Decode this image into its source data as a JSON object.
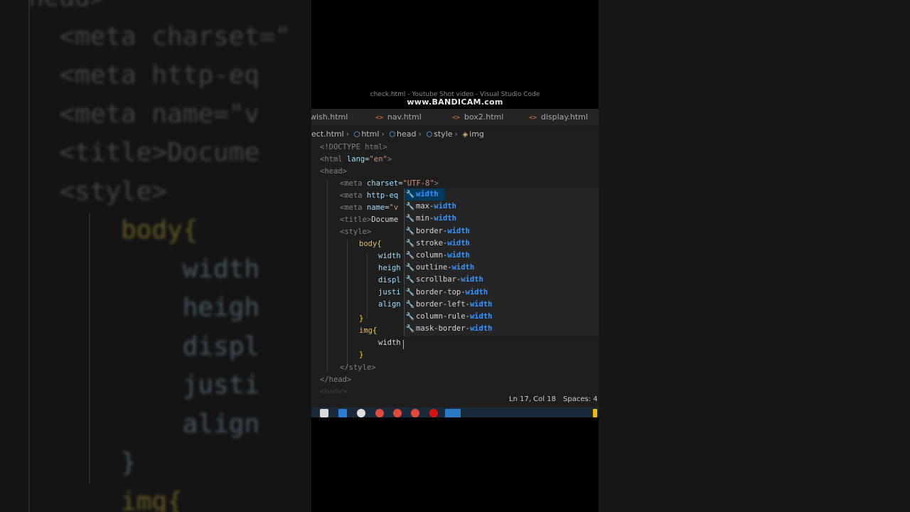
{
  "watermark": {
    "window_title": "check.html - Youtube Shot video - Visual Studio Code",
    "recorder": "www.BANDICAM.com"
  },
  "tabs": [
    {
      "label": "wish.html",
      "icon": "html-file-icon"
    },
    {
      "label": "nav.html",
      "icon": "html-file-icon"
    },
    {
      "label": "box2.html",
      "icon": "html-file-icon"
    },
    {
      "label": "display.html",
      "icon": "html-file-icon"
    }
  ],
  "breadcrumb": [
    "ect.html",
    "html",
    "head",
    "style",
    "img"
  ],
  "code": {
    "doctype": "<!DOCTYPE html>",
    "html_open_a": "<html",
    "html_open_b": " lang",
    "html_open_c": "=",
    "html_open_d": "\"en\"",
    "html_open_e": ">",
    "head_open": "<head>",
    "meta1_tag": "<meta",
    "meta1_attr": " charset",
    "meta1_eq": "=",
    "meta1_val": "\"UTF-8\"",
    "meta1_end": ">",
    "meta2_tag": "<meta",
    "meta2_attr": " http-eq",
    "meta3_tag": "<meta",
    "meta3_attr": " name",
    "meta3_eq": "=",
    "meta3_val": "\"v",
    "title_tag": "<title>",
    "title_text": "Docume",
    "style_open": "<style>",
    "body_sel": "body",
    "body_brace": "{",
    "prop1": "width",
    "prop2": "heigh",
    "prop3": "displ",
    "prop4": "justi",
    "prop5": "align",
    "close_brace": "}",
    "img_sel": "img",
    "img_brace": "{",
    "typing": "width",
    "img_close": "}",
    "style_close": "</style>",
    "head_close": "</head>",
    "body_partial": "<body>"
  },
  "suggestions": [
    {
      "prefix": "",
      "match": "width",
      "selected": true
    },
    {
      "prefix": "max-",
      "match": "width",
      "selected": false
    },
    {
      "prefix": "min-",
      "match": "width",
      "selected": false
    },
    {
      "prefix": "border-",
      "match": "width",
      "selected": false
    },
    {
      "prefix": "stroke-",
      "match": "width",
      "selected": false
    },
    {
      "prefix": "column-",
      "match": "width",
      "selected": false
    },
    {
      "prefix": "outline-",
      "match": "width",
      "selected": false
    },
    {
      "prefix": "scrollbar-",
      "match": "width",
      "selected": false
    },
    {
      "prefix": "border-top-",
      "match": "width",
      "selected": false
    },
    {
      "prefix": "border-left-",
      "match": "width",
      "selected": false
    },
    {
      "prefix": "column-rule-",
      "match": "width",
      "selected": false
    },
    {
      "prefix": "mask-border-",
      "match": "width",
      "selected": false
    }
  ],
  "status": {
    "position": "Ln 17, Col 18",
    "spaces": "Spaces: 4"
  },
  "background": {
    "lines": [
      "head>",
      "  <meta charset=\"",
      "  <meta http-eq",
      "  <meta name=\"v",
      "  <title>Docume",
      "  <style>",
      "      body{",
      "          width",
      "          heigh",
      "          displ",
      "          justi",
      "          align",
      "      }",
      "      img{"
    ]
  }
}
